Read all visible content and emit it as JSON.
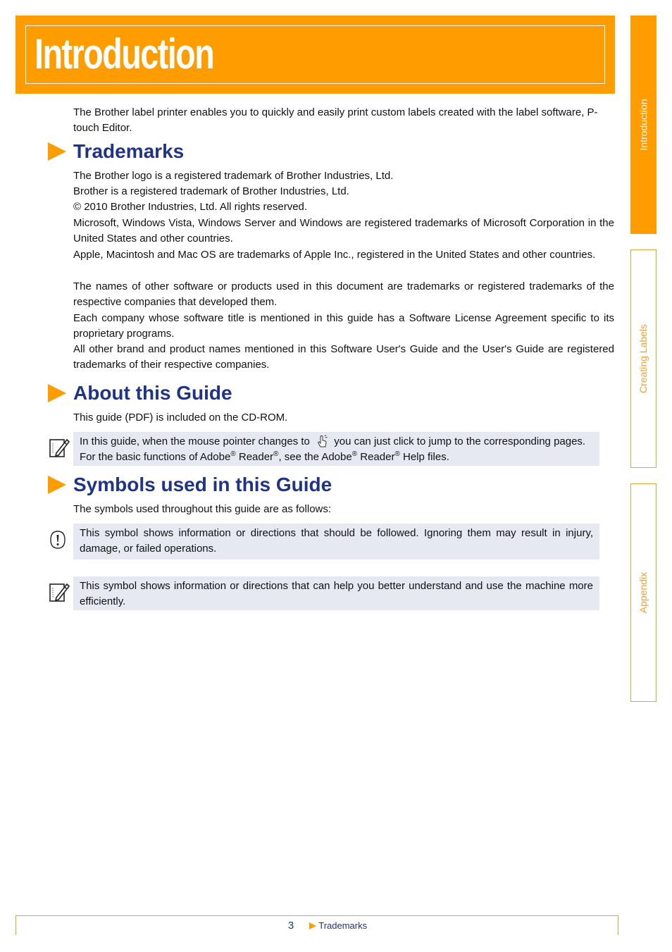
{
  "header": {
    "title": "Introduction"
  },
  "side_tabs": [
    {
      "label": "Introduction",
      "active": true
    },
    {
      "label": "Creating Labels",
      "active": false
    },
    {
      "label": "Appendix",
      "active": false
    }
  ],
  "intro": {
    "text": "The Brother label printer enables you to quickly and easily print custom labels created with the label software, P-touch Editor."
  },
  "trademarks": {
    "title": "Trademarks",
    "lines": [
      "The Brother logo is a registered trademark of Brother Industries, Ltd.",
      "Brother is a registered trademark of Brother Industries, Ltd.",
      "© 2010 Brother Industries, Ltd. All rights reserved.",
      "Microsoft, Windows Vista, Windows Server and Windows are registered trademarks of Microsoft Corporation in the United States and other countries.",
      "Apple, Macintosh and Mac OS are trademarks of Apple Inc., registered in the United States and other countries.",
      "The names of other software or products used in this document are trademarks or registered trademarks of the respective companies that developed them.",
      "Each company whose software title is mentioned in this guide has a Software License Agreement specific to its proprietary programs.",
      "All other brand and product names mentioned in this Software User's Guide and the User's Guide are registered trademarks of their respective companies."
    ]
  },
  "about": {
    "title": "About this Guide",
    "text": "This guide (PDF) is included on the CD-ROM.",
    "note": {
      "line1_before": "In this guide, when the mouse pointer changes to",
      "line1_after": "you can just click to jump to the corresponding pages.",
      "line2_part1": "For the basic functions of Adobe",
      "line2_part2": " Reader",
      "line2_part3": ", see the Adobe",
      "line2_part4": " Reader",
      "line2_part5": " Help files.",
      "reg": "®"
    }
  },
  "symbols": {
    "title": "Symbols used in this Guide",
    "text": "The symbols used throughout this guide are as follows:",
    "important": "This symbol shows information or directions that should be followed. Ignoring them may result in injury, damage, or failed operations.",
    "note": "This symbol shows information or directions that can help you better understand and use the machine more efficiently."
  },
  "footer": {
    "page_number": "3",
    "link": "Trademarks"
  },
  "colors": {
    "accent": "#ff9c00",
    "heading": "#1f3387",
    "note_bg": "#e6e8f2"
  }
}
